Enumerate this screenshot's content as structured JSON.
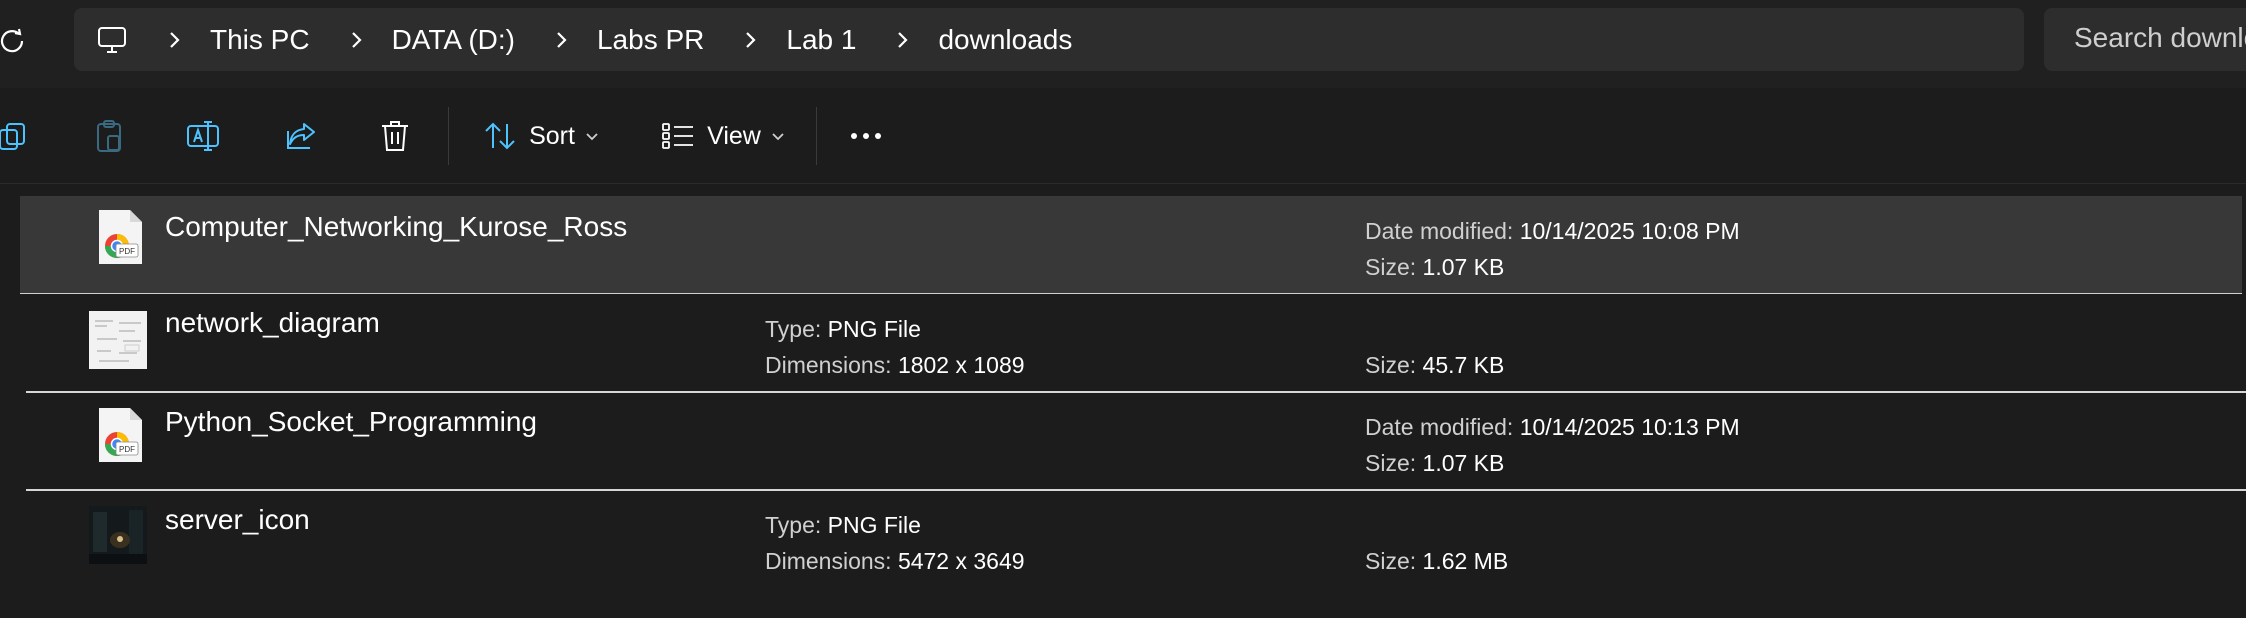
{
  "breadcrumb": {
    "items": [
      "This PC",
      "DATA (D:)",
      "Labs PR",
      "Lab 1",
      "downloads"
    ]
  },
  "search": {
    "placeholder": "Search downloads"
  },
  "toolbar": {
    "sort_label": "Sort",
    "view_label": "View"
  },
  "files": [
    {
      "name": "Computer_Networking_Kurose_Ross",
      "icon": "pdf-icon",
      "date_label": "Date modified:",
      "date_value": "10/14/2025 10:08 PM",
      "size_label": "Size:",
      "size_value": "1.07 KB"
    },
    {
      "name": "network_diagram",
      "icon": "png-thumbnail",
      "type_label": "Type:",
      "type_value": "PNG File",
      "dim_label": "Dimensions:",
      "dim_value": "1802 x 1089",
      "size_label": "Size:",
      "size_value": "45.7 KB"
    },
    {
      "name": "Python_Socket_Programming",
      "icon": "pdf-icon",
      "date_label": "Date modified:",
      "date_value": "10/14/2025 10:13 PM",
      "size_label": "Size:",
      "size_value": "1.07 KB"
    },
    {
      "name": "server_icon",
      "icon": "png-thumbnail",
      "type_label": "Type:",
      "type_value": "PNG File",
      "dim_label": "Dimensions:",
      "dim_value": "5472 x 3649",
      "size_label": "Size:",
      "size_value": "1.62 MB"
    }
  ],
  "colors": {
    "background": "#1c1c1c",
    "address_bar": "#2d2d2d",
    "selected_row": "#383838",
    "accent": "#4cc2ff"
  }
}
